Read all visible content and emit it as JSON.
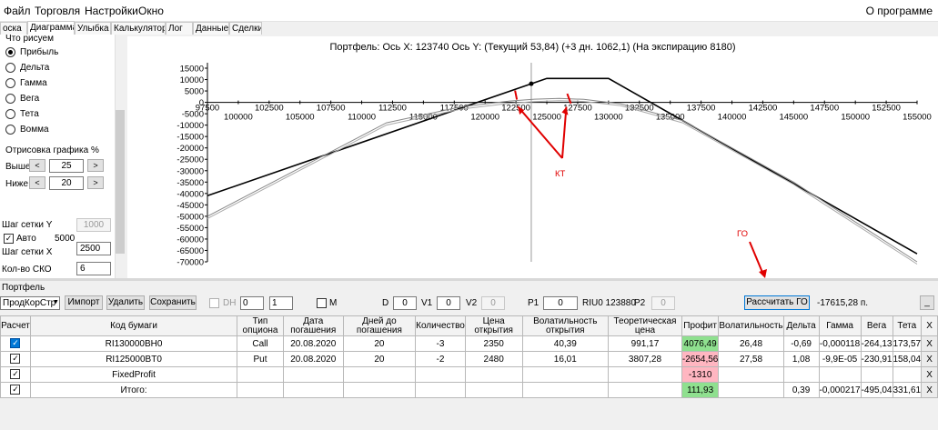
{
  "menu": {
    "items": [
      "Файл",
      "Торговля",
      "Настройки",
      "Окно"
    ],
    "about": "О программе"
  },
  "tabs": [
    "оска",
    "Диаграмма",
    "Улыбка",
    "Калькулятор",
    "Лог",
    "Данные",
    "Сделки"
  ],
  "left_panel": {
    "group_title": "Что рисуем",
    "radios": [
      {
        "label": "Прибыль",
        "selected": true
      },
      {
        "label": "Дельта",
        "selected": false
      },
      {
        "label": "Гамма",
        "selected": false
      },
      {
        "label": "Вега",
        "selected": false
      },
      {
        "label": "Тета",
        "selected": false
      },
      {
        "label": "Вомма",
        "selected": false
      }
    ],
    "draw_group": "Отрисовка графика %",
    "above_label": "Выше",
    "above_value": "25",
    "below_label": "Ниже",
    "below_value": "20",
    "grid_y_label": "Шаг сетки Y",
    "grid_y_value": "1000",
    "auto_label": "Авто",
    "auto_value": "5000",
    "grid_x_label": "Шаг сетки X",
    "grid_x_value": "2500",
    "sko_label": "Кол-во СКО",
    "sko_value": "6"
  },
  "chart": {
    "title": "Портфель: Ось X: 123740 Ось Y:  (Текущий 53,84)  (+3 дн. 1062,1)  (На экспирацию 8180)",
    "annotations": {
      "kt": "КТ",
      "go": "ГО"
    }
  },
  "chart_data": {
    "type": "line",
    "title": "Портфель: Ось X: 123740 Ось Y:  (Текущий 53,84)  (+3 дн. 1062,1)  (На экспирацию 8180)",
    "xlim": [
      97500,
      155000
    ],
    "ylim": [
      -70000,
      15000
    ],
    "y_ticks": [
      15000,
      10000,
      5000,
      0,
      -5000,
      -10000,
      -15000,
      -20000,
      -25000,
      -30000,
      -35000,
      -40000,
      -45000,
      -50000,
      -55000,
      -60000,
      -65000,
      -70000
    ],
    "x_ticks_upper": [
      97500,
      102500,
      107500,
      112500,
      117500,
      122500,
      127500,
      132500,
      137500,
      142500,
      147500,
      152500
    ],
    "x_ticks_lower": [
      100000,
      105000,
      110000,
      115000,
      120000,
      125000,
      130000,
      135000,
      140000,
      145000,
      150000,
      155000
    ],
    "current_x": 123740,
    "series": [
      {
        "color": "#000000",
        "x": [
          97500,
          123740,
          125000,
          130000,
          155000
        ],
        "y": [
          -41000,
          8180,
          10500,
          10500,
          -66500
        ]
      },
      {
        "color": "#888888",
        "x": [
          97500,
          112000,
          118000,
          122000,
          124000,
          126000,
          128000,
          131000,
          136000,
          145000,
          155000
        ],
        "y": [
          -50000,
          -9000,
          -2000,
          600,
          1400,
          1700,
          1300,
          -700,
          -8000,
          -35000,
          -70000
        ]
      },
      {
        "color": "#aaaaaa",
        "x": [
          97500,
          112000,
          118000,
          122000,
          124000,
          126000,
          128000,
          131000,
          136000,
          145000,
          155000
        ],
        "y": [
          -51000,
          -10000,
          -3000,
          -400,
          300,
          700,
          400,
          -1500,
          -9000,
          -36000,
          -71000
        ]
      }
    ]
  },
  "portfolio_section": {
    "label": "Портфель",
    "selector_value": "ПродКорСтр",
    "import_btn": "Импорт",
    "delete_btn": "Удалить",
    "save_btn": "Сохранить",
    "dh_label": "DH",
    "dh_value1": "0",
    "dh_value2": "1",
    "m_label": "M",
    "d_label": "D",
    "d_value": "0",
    "v1_label": "V1",
    "v1_value": "0",
    "v2_label": "V2",
    "v2_value": "0",
    "p1_label": "P1",
    "p1_value": "0",
    "riu_text": "RIU0 123880",
    "p2_label": "P2",
    "p2_value": "0",
    "calc_btn": "Рассчитать ГО",
    "go_value": "-17615,28 п.",
    "menu_btn": "_"
  },
  "table": {
    "headers": [
      "Расчет",
      "Код бумаги",
      "Тип\nопциона",
      "Дата\nпогашения",
      "Дней до\nпогашения",
      "Количество",
      "Цена\nоткрытия",
      "Волатильность\nоткрытия",
      "Теоретическая\nцена",
      "Профит",
      "Волатильность",
      "Дельта",
      "Гамма",
      "Вега",
      "Тета",
      "X"
    ],
    "rows": [
      {
        "selected": true,
        "cells": [
          "RI130000BH0",
          "Call",
          "20.08.2020",
          "20",
          "-3",
          "2350",
          "40,39",
          "991,17",
          "4076,49",
          "26,48",
          "-0,69",
          "-0,000118",
          "-264,13",
          "173,57",
          "X"
        ],
        "profit_color": "green"
      },
      {
        "selected": false,
        "cells": [
          "RI125000BT0",
          "Put",
          "20.08.2020",
          "20",
          "-2",
          "2480",
          "16,01",
          "3807,28",
          "-2654,56",
          "27,58",
          "1,08",
          "-9,9E-05",
          "-230,91",
          "158,04",
          "X"
        ],
        "profit_color": "pink"
      },
      {
        "selected": false,
        "cells": [
          "FixedProfit",
          "",
          "",
          "",
          "",
          "",
          "",
          "",
          "-1310",
          "",
          "",
          "",
          "",
          "",
          "X"
        ],
        "profit_color": "pink"
      },
      {
        "selected": false,
        "cells": [
          "Итого:",
          "",
          "",
          "",
          "",
          "",
          "",
          "",
          "111,93",
          "",
          "0,39",
          "-0,000217",
          "-495,04",
          "331,61",
          "X"
        ],
        "profit_color": "green"
      }
    ]
  }
}
